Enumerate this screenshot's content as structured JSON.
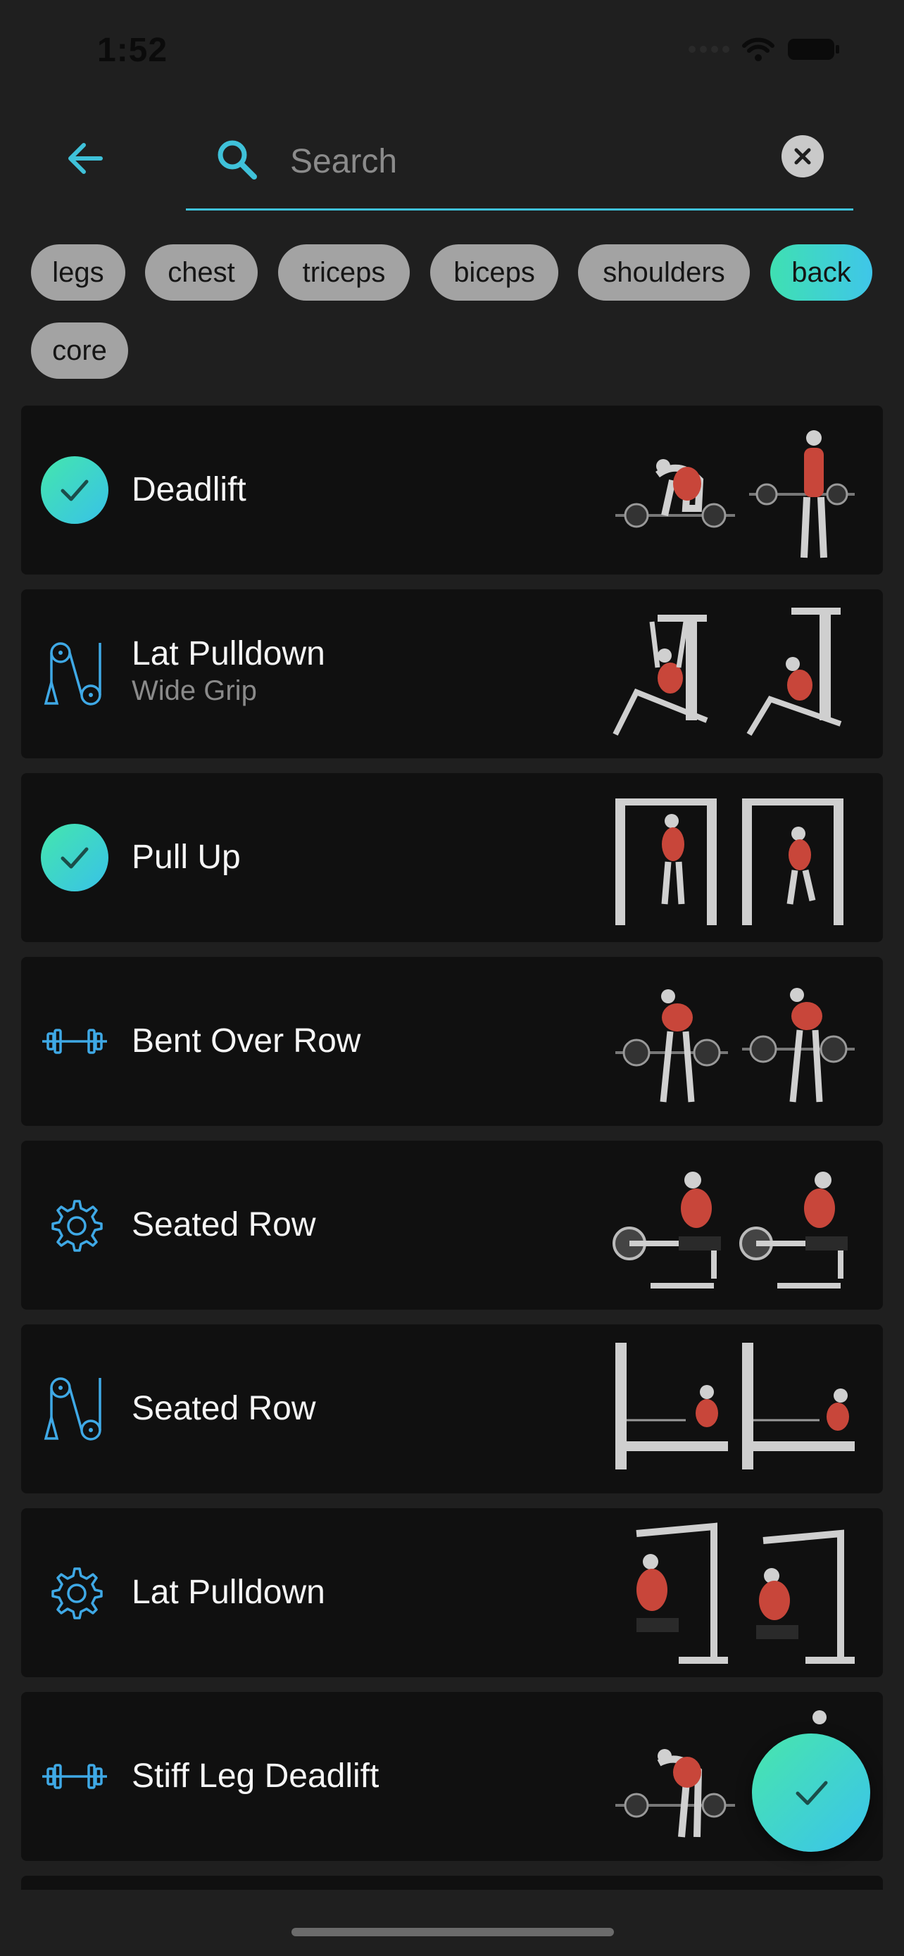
{
  "status_bar": {
    "time": "1:52"
  },
  "search": {
    "placeholder": "Search",
    "value": ""
  },
  "filters": [
    {
      "label": "legs",
      "active": false
    },
    {
      "label": "chest",
      "active": false
    },
    {
      "label": "triceps",
      "active": false
    },
    {
      "label": "biceps",
      "active": false
    },
    {
      "label": "shoulders",
      "active": false
    },
    {
      "label": "back",
      "active": true
    },
    {
      "label": "core",
      "active": false
    }
  ],
  "exercises": [
    {
      "title": "Deadlift",
      "subtitle": "",
      "icon": "check-icon",
      "selected": true
    },
    {
      "title": "Lat Pulldown",
      "subtitle": "Wide Grip",
      "icon": "cable-icon",
      "selected": false
    },
    {
      "title": "Pull Up",
      "subtitle": "",
      "icon": "check-icon",
      "selected": true
    },
    {
      "title": "Bent Over Row",
      "subtitle": "",
      "icon": "barbell-icon",
      "selected": false
    },
    {
      "title": "Seated Row",
      "subtitle": "",
      "icon": "machine-gear-icon",
      "selected": false
    },
    {
      "title": "Seated Row",
      "subtitle": "",
      "icon": "cable-icon",
      "selected": false
    },
    {
      "title": "Lat Pulldown",
      "subtitle": "",
      "icon": "machine-gear-icon",
      "selected": false
    },
    {
      "title": "Stiff Leg Deadlift",
      "subtitle": "",
      "icon": "barbell-icon",
      "selected": false
    }
  ],
  "colors": {
    "accent": "#3fc1d9",
    "chip": "#a3a3a3",
    "card": "#101010",
    "background": "#1f1f1f"
  }
}
